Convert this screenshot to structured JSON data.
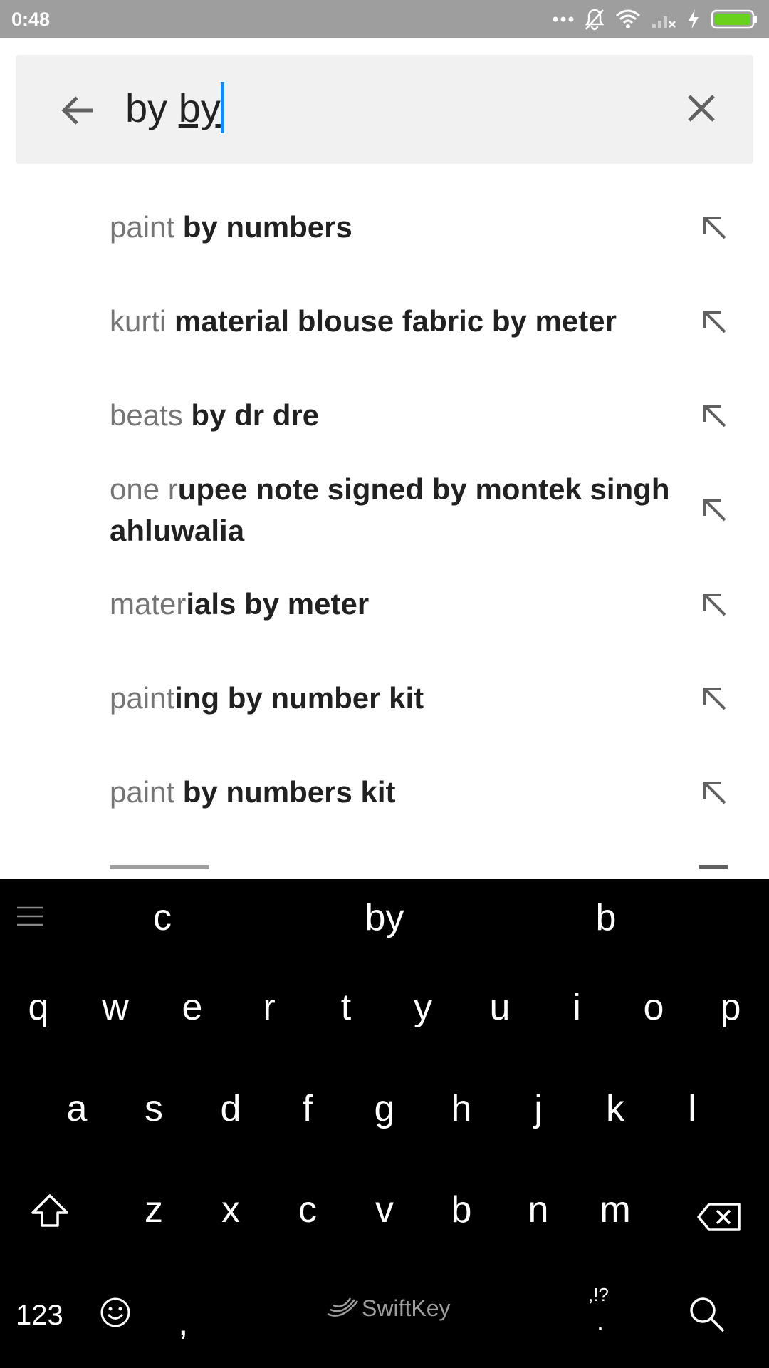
{
  "status_bar": {
    "time": "0:48",
    "icons": [
      "more-dots-icon",
      "mute-bell-icon",
      "wifi-icon",
      "signal-off-icon",
      "charging-bolt-icon",
      "battery-icon"
    ],
    "battery_color": "#6ad11f"
  },
  "search": {
    "prefix": "by ",
    "typed": "by",
    "cursor_color": "#1e88e5"
  },
  "suggestions": [
    {
      "pre": "paint ",
      "post": "by numbers"
    },
    {
      "pre": "kurti ",
      "post": "material blouse fabric by meter"
    },
    {
      "pre": "beats ",
      "post": "by dr dre"
    },
    {
      "pre": "one r",
      "post": "upee note signed by montek singh ahluwalia"
    },
    {
      "pre": "mater",
      "post": "ials by meter"
    },
    {
      "pre": "paint",
      "post": "ing by number kit"
    },
    {
      "pre": "paint ",
      "post": "by numbers kit"
    }
  ],
  "keyboard": {
    "predictions": [
      "c",
      "by",
      "b"
    ],
    "row1": [
      "q",
      "w",
      "e",
      "r",
      "t",
      "y",
      "u",
      "i",
      "o",
      "p"
    ],
    "row2": [
      "a",
      "s",
      "d",
      "f",
      "g",
      "h",
      "j",
      "k",
      "l"
    ],
    "row3": [
      "z",
      "x",
      "c",
      "v",
      "b",
      "n",
      "m"
    ],
    "numbers_label": "123",
    "comma_label": ",",
    "brand_label": "SwiftKey",
    "punct_label": ",!?",
    "period_label": "."
  }
}
